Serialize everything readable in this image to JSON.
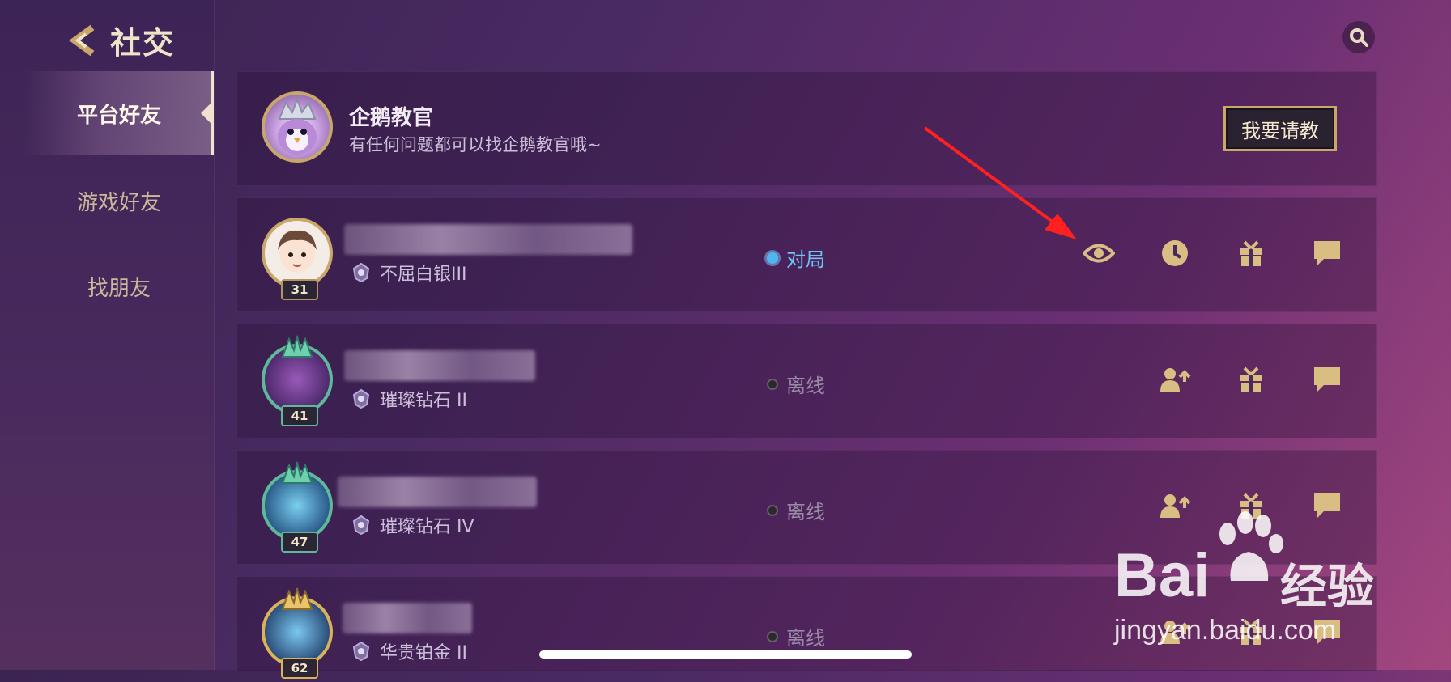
{
  "header": {
    "back_label": "社交"
  },
  "sidebar": {
    "items": [
      {
        "label": "平台好友",
        "active": true
      },
      {
        "label": "游戏好友",
        "active": false
      },
      {
        "label": "找朋友",
        "active": false
      }
    ]
  },
  "search": {
    "icon": "search-icon"
  },
  "bot_card": {
    "name": "企鹅教官",
    "description": "有任何问题都可以找企鹅教官哦~",
    "button_label": "我要请教"
  },
  "friends": [
    {
      "level": "31",
      "rank": "不屈白银III",
      "status": "对局",
      "status_color": "#4fb6f2",
      "actions": [
        "eye-icon",
        "clock-icon",
        "gift-icon",
        "chat-icon"
      ]
    },
    {
      "level": "41",
      "rank": "璀璨钻石 II",
      "status": "离线",
      "status_color": "#2a2a2a",
      "actions": [
        "add-friend-icon",
        "gift-icon",
        "chat-icon"
      ]
    },
    {
      "level": "47",
      "rank": "璀璨钻石 IV",
      "status": "离线",
      "status_color": "#2a2a2a",
      "actions": [
        "add-friend-icon",
        "gift-icon",
        "chat-icon"
      ]
    },
    {
      "level": "62",
      "rank": "华贵铂金 II",
      "status": "离线",
      "status_color": "#2a2a2a",
      "actions": [
        "add-friend-icon",
        "gift-icon",
        "chat-icon"
      ]
    }
  ],
  "colors": {
    "accent_gold": "#c9a76a",
    "icon_gold": "#d8be82"
  },
  "watermark": {
    "brand": "Bai",
    "label": "经验",
    "url": "jingyan.baidu.com"
  }
}
